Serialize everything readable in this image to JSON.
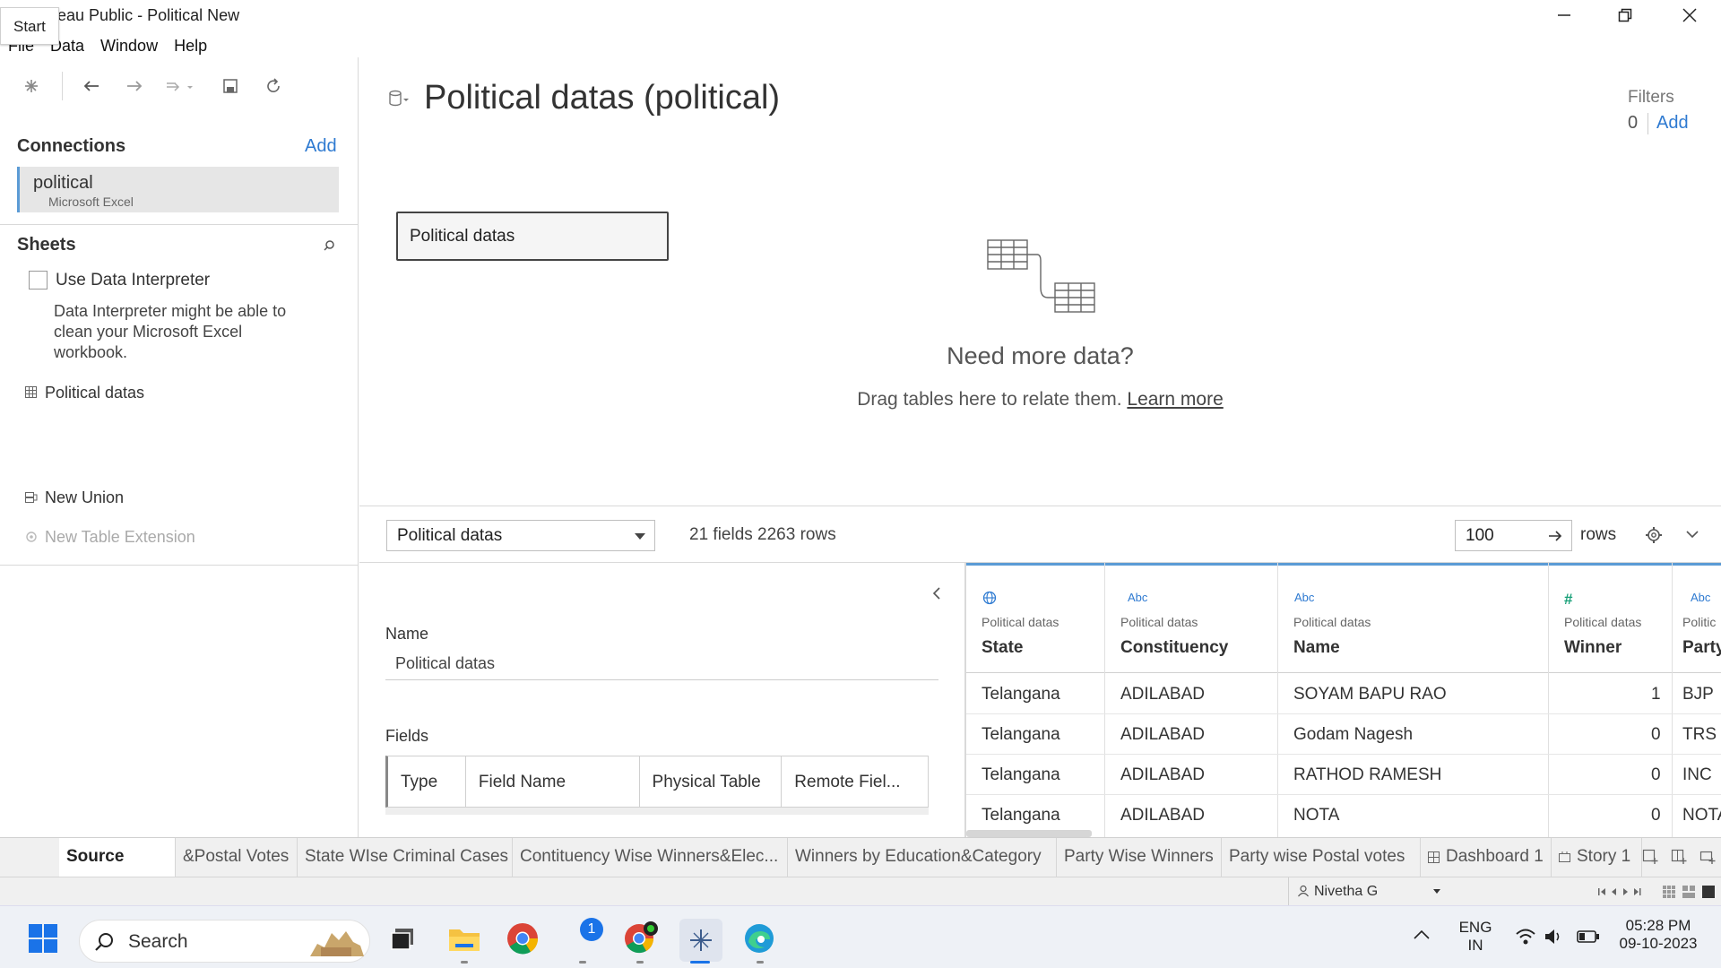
{
  "window": {
    "title": "Tableau Public - Political New"
  },
  "menu": [
    "File",
    "Data",
    "Window",
    "Help"
  ],
  "left_pane": {
    "connections_title": "Connections",
    "add_label": "Add",
    "connection": {
      "name": "political",
      "type": "Microsoft Excel"
    },
    "sheets_title": "Sheets",
    "use_interpreter": "Use Data Interpreter",
    "interpreter_checked": false,
    "interpreter_note": "Data Interpreter might be able to clean your Microsoft Excel workbook.",
    "sheet_item": "Political datas",
    "new_union": "New Union",
    "new_table_extension": "New Table Extension"
  },
  "canvas": {
    "datasource_title": "Political datas (political)",
    "filters_label": "Filters",
    "filters_count": "0",
    "filters_add": "Add",
    "table_box": "Political datas",
    "need_more": "Need more data?",
    "drag_hint": "Drag tables here to relate them.",
    "learn_more": "Learn more"
  },
  "grid_toolbar": {
    "table_select": "Political datas",
    "field_count": "21 fields 2263 rows",
    "rows_value": "100",
    "rows_label": "rows"
  },
  "metadata": {
    "name_label": "Name",
    "name_value": "Political datas",
    "fields_label": "Fields",
    "columns": [
      "Type",
      "Field Name",
      "Physical Table",
      "Remote Fiel..."
    ]
  },
  "grid": {
    "columns": [
      {
        "icon": "globe-icon",
        "source": "Political datas",
        "name": "State"
      },
      {
        "icon": "Abc",
        "source": "Political datas",
        "name": "Constituency"
      },
      {
        "icon": "Abc",
        "source": "Political datas",
        "name": "Name"
      },
      {
        "icon": "#",
        "source": "Political datas",
        "name": "Winner"
      },
      {
        "icon": "Abc",
        "source": "Politic",
        "name": "Party"
      }
    ],
    "rows": [
      [
        "Telangana",
        "ADILABAD",
        "SOYAM BAPU RAO",
        "1",
        "BJP"
      ],
      [
        "Telangana",
        "ADILABAD",
        "Godam Nagesh",
        "0",
        "TRS"
      ],
      [
        "Telangana",
        "ADILABAD",
        "RATHOD RAMESH",
        "0",
        "INC"
      ],
      [
        "Telangana",
        "ADILABAD",
        "NOTA",
        "0",
        "NOTA"
      ]
    ]
  },
  "tabs": {
    "start": "Start",
    "items": [
      "Source",
      "&Postal Votes",
      "State WIse Criminal Cases",
      "Contituency Wise Winners&Elec...",
      "Winners by Education&Category",
      "Party Wise Winners",
      "Party wise Postal votes",
      "Dashboard 1",
      "Story 1"
    ]
  },
  "status": {
    "user": "Nivetha G"
  },
  "taskbar": {
    "search": "Search",
    "badge": "1",
    "lang_top": "ENG",
    "lang_bottom": "IN",
    "time": "05:28 PM",
    "date": "09-10-2023"
  },
  "colors": {
    "accent": "#2e7ad1",
    "header_rule": "#5b9bd5"
  }
}
